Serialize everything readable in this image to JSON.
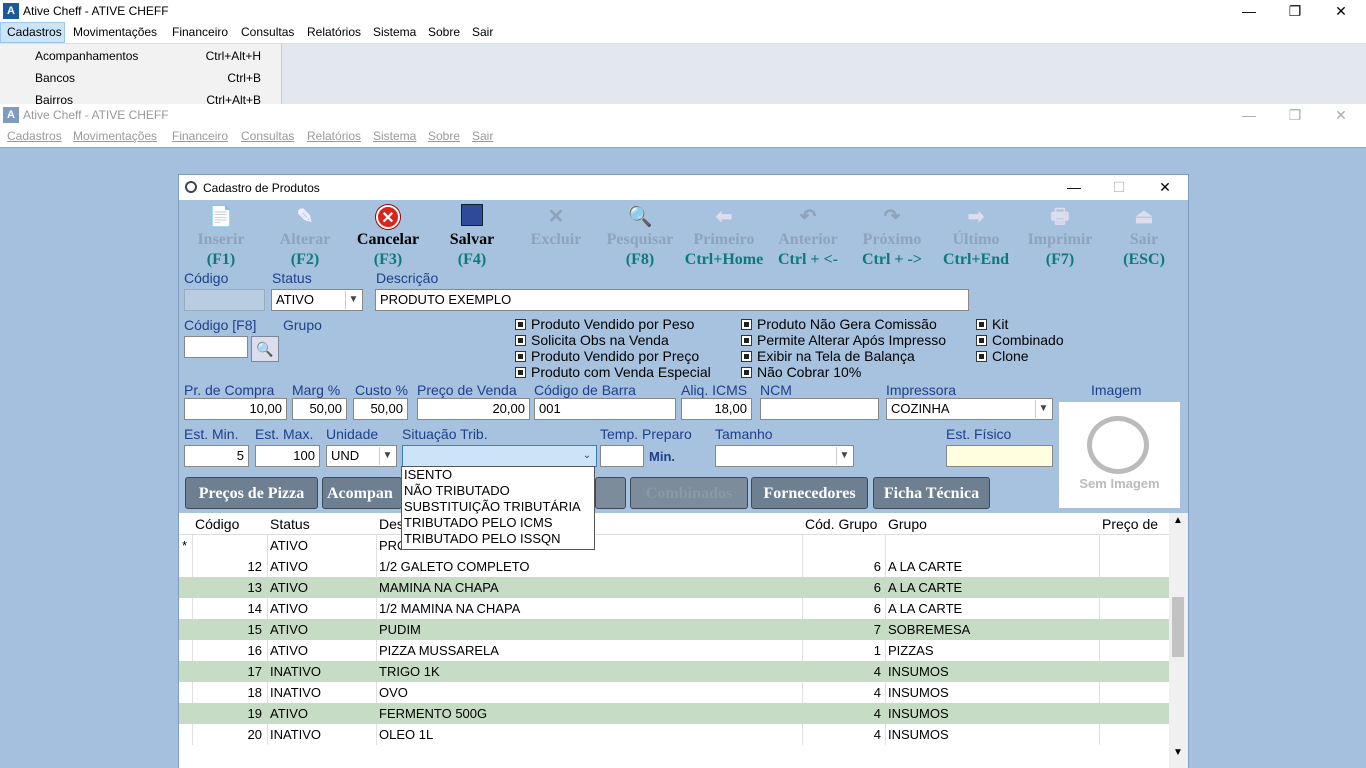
{
  "outer": {
    "title": "Ative Cheff - ATIVE CHEFF",
    "menu": [
      "Cadastros",
      "Movimentações",
      "Financeiro",
      "Consultas",
      "Relatórios",
      "Sistema",
      "Sobre",
      "Sair"
    ],
    "dropdown": [
      {
        "label": "Acompanhamentos",
        "shortcut": "Ctrl+Alt+H"
      },
      {
        "label": "Bancos",
        "shortcut": "Ctrl+B"
      },
      {
        "label": "Bairros",
        "shortcut": "Ctrl+Alt+B"
      }
    ]
  },
  "inner": {
    "title": "Ative Cheff - ATIVE CHEFF",
    "menu": [
      "Cadastros",
      "Movimentações",
      "Financeiro",
      "Consultas",
      "Relatórios",
      "Sistema",
      "Sobre",
      "Sair"
    ]
  },
  "dialog": {
    "title": "Cadastro de Produtos",
    "toolbar": [
      {
        "label": "Inserir",
        "key": "(F1)",
        "icon": "file-icon",
        "enabled": false
      },
      {
        "label": "Alterar",
        "key": "(F2)",
        "icon": "edit-icon",
        "enabled": false
      },
      {
        "label": "Cancelar",
        "key": "(F3)",
        "icon": "cancel-icon",
        "enabled": true
      },
      {
        "label": "Salvar",
        "key": "(F4)",
        "icon": "save-icon",
        "enabled": true
      },
      {
        "label": "Excluir",
        "key": "",
        "icon": "delete-icon",
        "enabled": false
      },
      {
        "label": "Pesquisar",
        "key": "(F8)",
        "icon": "search-icon",
        "enabled": false
      },
      {
        "label": "Primeiro",
        "key": "Ctrl+Home",
        "icon": "first-icon",
        "enabled": false
      },
      {
        "label": "Anterior",
        "key": "Ctrl + <-",
        "icon": "previous-icon",
        "enabled": false
      },
      {
        "label": "Próximo",
        "key": "Ctrl + ->",
        "icon": "next-icon",
        "enabled": false
      },
      {
        "label": "Último",
        "key": "Ctrl+End",
        "icon": "last-icon",
        "enabled": false
      },
      {
        "label": "Imprimir",
        "key": "(F7)",
        "icon": "print-icon",
        "enabled": false
      },
      {
        "label": "Sair",
        "key": "(ESC)",
        "icon": "exit-icon",
        "enabled": false
      }
    ],
    "labels": {
      "codigo": "Código",
      "status": "Status",
      "descricao": "Descrição",
      "codigo_f8": "Código [F8]",
      "grupo": "Grupo",
      "pr_compra": "Pr. de Compra",
      "marg": "Marg %",
      "custo": "Custo %",
      "preco_venda": "Preço de Venda",
      "cod_barra": "Código de Barra",
      "aliq_icms": "Aliq. ICMS",
      "ncm": "NCM",
      "impressora": "Impressora",
      "imagem": "Imagem",
      "est_min": "Est. Min.",
      "est_max": "Est. Max.",
      "unidade": "Unidade",
      "sit_trib": "Situação Trib.",
      "temp_preparo": "Temp. Preparo",
      "min": "Min.",
      "tamanho": "Tamanho",
      "est_fisico": "Est. Físico",
      "sem_imagem": "Sem Imagem"
    },
    "values": {
      "status": "ATIVO",
      "descricao": "PRODUTO EXEMPLO",
      "pr_compra": "10,00",
      "marg": "50,00",
      "custo": "50,00",
      "preco_venda": "20,00",
      "cod_barra": "001",
      "aliq_icms": "18,00",
      "impressora": "COZINHA",
      "est_min": "5",
      "est_max": "100",
      "unidade": "UND"
    },
    "checkboxes": [
      "Produto Vendido por Peso",
      "Solicita Obs na Venda",
      "Produto Vendido por Preço",
      "Produto com Venda Especial",
      "Produto Não Gera Comissão",
      "Permite Alterar Após Impresso",
      "Exibir na Tela de Balança",
      "Não Cobrar 10%",
      "Kit",
      "Combinado",
      "Clone"
    ],
    "tabs": [
      "Preços de Pizza",
      "Acompan",
      "Combinados",
      "Fornecedores",
      "Ficha Técnica"
    ],
    "sit_trib_options": [
      "ISENTO",
      "NÃO TRIBUTADO",
      "SUBSTITUIÇÃO TRIBUTÁRIA",
      "TRIBUTADO PELO ICMS",
      "TRIBUTADO PELO ISSQN"
    ],
    "grid": {
      "headers": [
        "Código",
        "Status",
        "Des",
        "Cód. Grupo",
        "Grupo",
        "Preço de"
      ],
      "new_row": {
        "marker": "*",
        "status": "ATIVO",
        "desc": "PRO"
      },
      "rows": [
        {
          "codigo": "12",
          "status": "ATIVO",
          "desc": "1/2 GALETO COMPLETO",
          "cod_grupo": "6",
          "grupo": "A LA CARTE"
        },
        {
          "codigo": "13",
          "status": "ATIVO",
          "desc": "MAMINA NA CHAPA",
          "cod_grupo": "6",
          "grupo": "A LA CARTE"
        },
        {
          "codigo": "14",
          "status": "ATIVO",
          "desc": "1/2 MAMINA NA CHAPA",
          "cod_grupo": "6",
          "grupo": "A LA CARTE"
        },
        {
          "codigo": "15",
          "status": "ATIVO",
          "desc": "PUDIM",
          "cod_grupo": "7",
          "grupo": "SOBREMESA"
        },
        {
          "codigo": "16",
          "status": "ATIVO",
          "desc": "PIZZA MUSSARELA",
          "cod_grupo": "1",
          "grupo": "PIZZAS"
        },
        {
          "codigo": "17",
          "status": "INATIVO",
          "desc": "TRIGO 1K",
          "cod_grupo": "4",
          "grupo": "INSUMOS"
        },
        {
          "codigo": "18",
          "status": "INATIVO",
          "desc": "OVO",
          "cod_grupo": "4",
          "grupo": "INSUMOS"
        },
        {
          "codigo": "19",
          "status": "ATIVO",
          "desc": "FERMENTO 500G",
          "cod_grupo": "4",
          "grupo": "INSUMOS"
        },
        {
          "codigo": "20",
          "status": "INATIVO",
          "desc": "OLEO 1L",
          "cod_grupo": "4",
          "grupo": "INSUMOS"
        }
      ]
    }
  }
}
